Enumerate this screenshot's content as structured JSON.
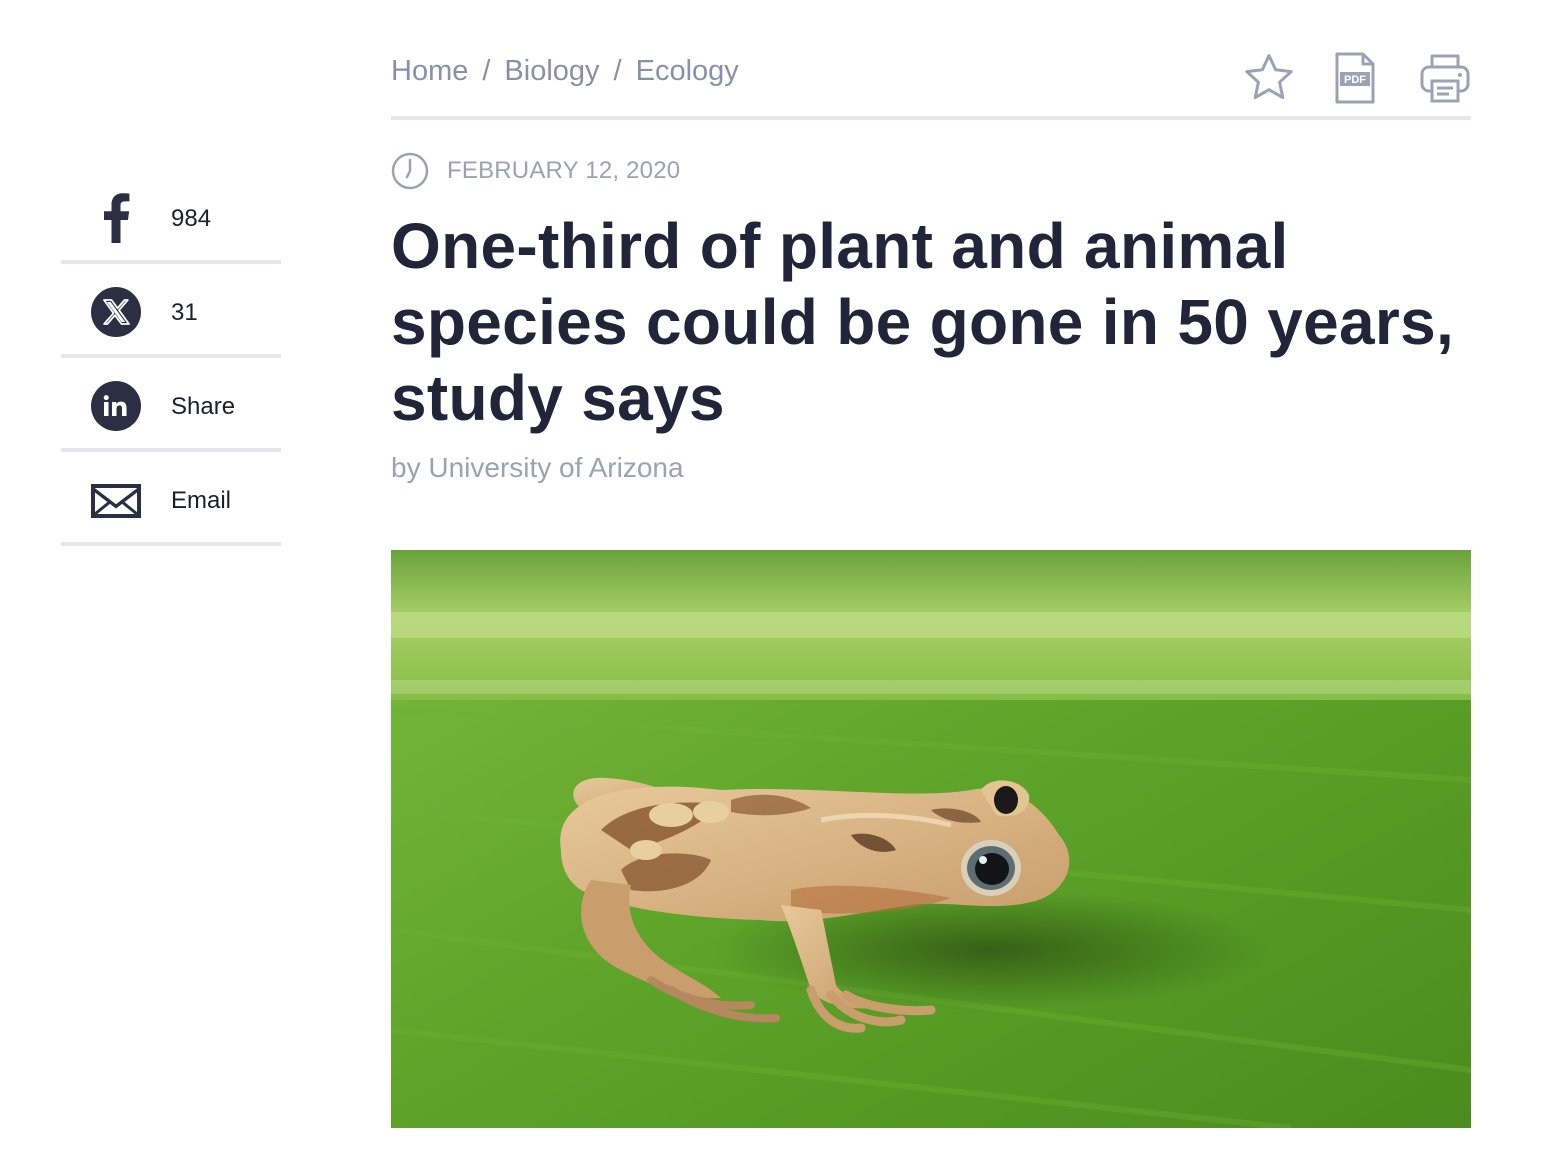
{
  "share": {
    "facebook": {
      "icon": "facebook-icon",
      "count": "984"
    },
    "x": {
      "icon": "x-icon",
      "count": "31"
    },
    "linkedin": {
      "icon": "linkedin-icon",
      "label": "Share"
    },
    "email": {
      "icon": "email-icon",
      "label": "Email"
    }
  },
  "breadcrumb": {
    "items": [
      "Home",
      "Biology",
      "Ecology"
    ],
    "separator": "/"
  },
  "tools": {
    "bookmark": "star-icon",
    "pdf": "pdf-icon",
    "pdf_text": "PDF",
    "print": "print-icon"
  },
  "article": {
    "date": "FEBRUARY 12, 2020",
    "title": "One-third of plant and animal species could be gone in 50 years, study says",
    "byline": "by University of Arizona"
  },
  "colors": {
    "text_dark": "#22253a",
    "text_muted": "#8b8fa8",
    "divider": "#e6e6ec",
    "icon_dark": "#2c2f43"
  }
}
